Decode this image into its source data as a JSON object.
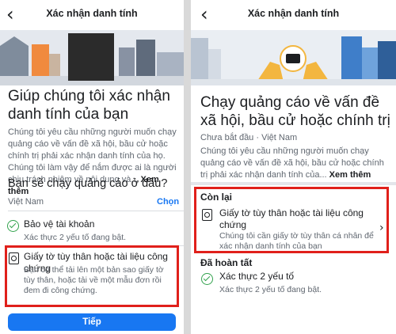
{
  "left": {
    "header_title": "Xác nhận danh tính",
    "heading": "Giúp chúng tôi xác nhận danh tính của bạn",
    "intro": "Chúng tôi yêu cầu những người muốn chạy quảng cáo về vấn đề xã hội, bầu cử hoặc chính trị phải xác nhận danh tính của họ. Chúng tôi làm vậy để nắm được ai là người chịu trách nhiệm về nội dung và...",
    "see_more": "Xem thêm",
    "question": "Bạn sẽ chạy quảng cáo ở đâu?",
    "country": "Việt Nam",
    "choose": "Chọn",
    "items": [
      {
        "title": "Bảo vệ tài khoản",
        "sub": "Xác thực 2 yếu tố đang bật."
      },
      {
        "title": "Giấy tờ tùy thân hoặc tài liệu công chứng",
        "sub": "Bạn có thể tải lên một bản sao giấy tờ tùy thân, hoặc tải về một mẫu đơn rồi đem đi công chứng."
      }
    ],
    "next_button": "Tiếp"
  },
  "right": {
    "header_title": "Xác nhận danh tính",
    "heading": "Chạy quảng cáo về vấn đề xã hội, bầu cử hoặc chính trị",
    "status": "Chưa bắt đầu · Việt Nam",
    "intro": "Chúng tôi yêu cầu những người muốn chạy quảng cáo về vấn đề xã hội, bầu cử hoặc chính trị phải xác nhận danh tính của...",
    "see_more": "Xem thêm",
    "remaining_label": "Còn lại",
    "remaining_item": {
      "title": "Giấy tờ tùy thân hoặc tài liệu công chứng",
      "sub": "Chúng tôi cần giấy tờ tùy thân cá nhân để xác nhận danh tính của bạn"
    },
    "done_label": "Đã hoàn tất",
    "done_item": {
      "title": "Xác thực 2 yếu tố",
      "sub": "Xác thực 2 yếu tố đang bật."
    }
  },
  "colors": {
    "accent": "#1877f2",
    "highlight": "#e0201b",
    "success": "#31a24c"
  }
}
